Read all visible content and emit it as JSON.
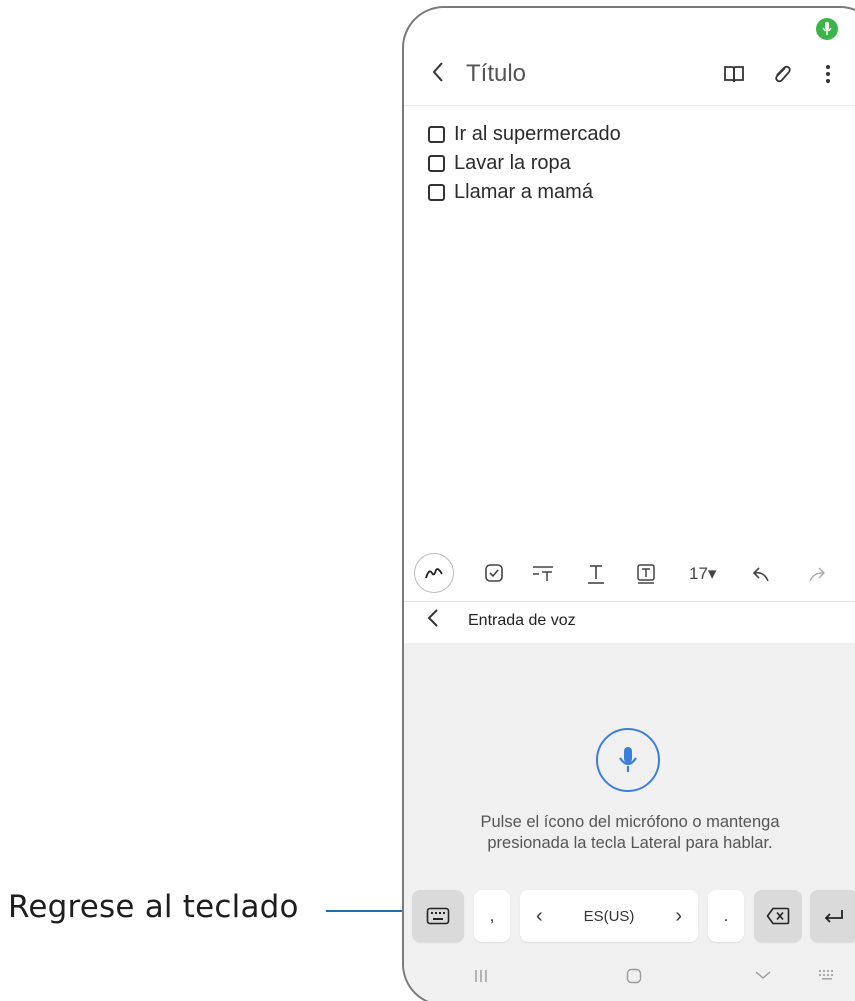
{
  "callout": {
    "label": "Regrese al teclado"
  },
  "header": {
    "title": "Título",
    "back_glyph": "〈"
  },
  "checklist": {
    "items": [
      {
        "label": "Ir al supermercado",
        "checked": false
      },
      {
        "label": "Lavar la ropa",
        "checked": false
      },
      {
        "label": "Llamar a mamá",
        "checked": false
      }
    ]
  },
  "toolbar": {
    "font_size": "17▾"
  },
  "voice_input": {
    "title": "Entrada de voz",
    "back_glyph": "〈",
    "hint_line1": "Pulse el ícono del micrófono o mantenga",
    "hint_line2": "presionada la tecla Lateral para hablar."
  },
  "keyboard": {
    "comma": ",",
    "lang_prev": "‹",
    "language": "ES(US)",
    "lang_next": "›",
    "period": "."
  },
  "colors": {
    "accent_blue": "#3c7fd9",
    "mic_active_green": "#3bb54a",
    "callout_line": "#1f6fb0",
    "voice_panel_bg": "#f0f0f0"
  },
  "icons": [
    "mic-indicator-icon",
    "back-icon",
    "book-icon",
    "attach-icon",
    "more-options-icon",
    "pen-icon",
    "checkbox-icon",
    "text-style-icon",
    "text-format-icon",
    "text-box-icon",
    "undo-icon",
    "redo-icon",
    "microphone-icon",
    "keyboard-icon",
    "backspace-icon",
    "enter-icon",
    "recents-icon",
    "home-icon",
    "nav-back-icon",
    "keyboard-toggle-icon"
  ]
}
